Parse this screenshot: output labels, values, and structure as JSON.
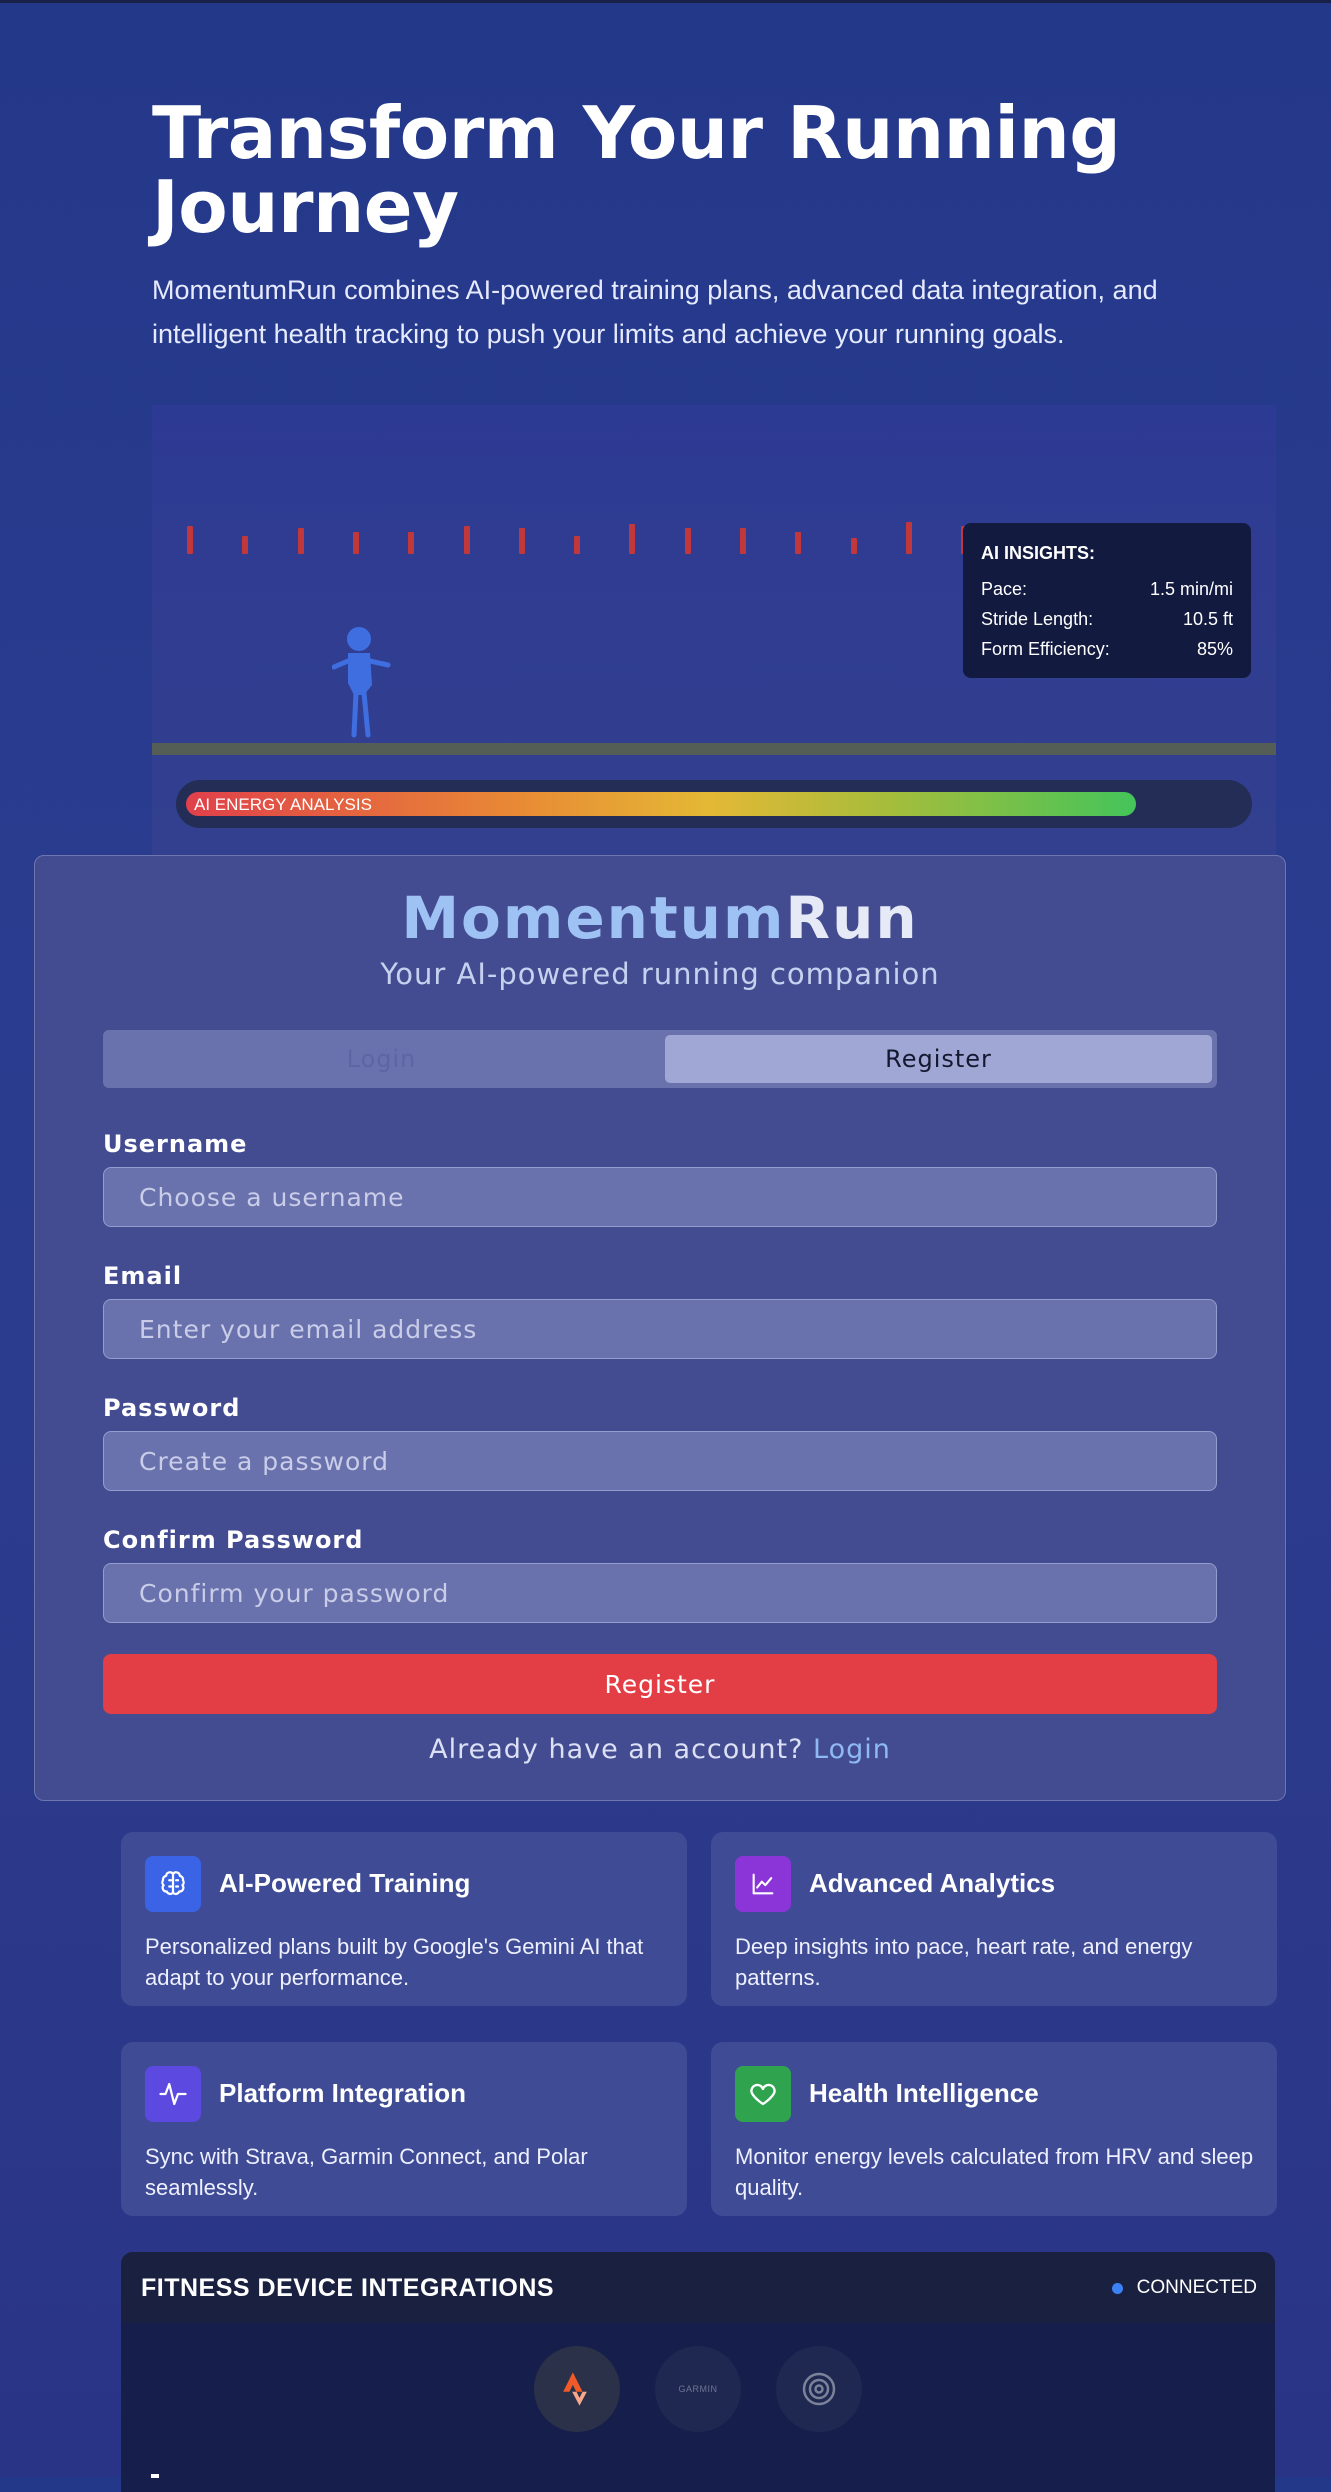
{
  "hero": {
    "title": "Transform Your Running Journey",
    "subtitle": "MomentumRun combines AI-powered training plans, advanced data integration, and intelligent health tracking to push your limits and achieve your running goals."
  },
  "visualization": {
    "insights_title": "AI INSIGHTS:",
    "metrics": [
      {
        "label": "Pace:",
        "value": "1.5 min/mi"
      },
      {
        "label": "Stride Length:",
        "value": "10.5 ft"
      },
      {
        "label": "Form Efficiency:",
        "value": "85%"
      }
    ],
    "energy_label": "AI ENERGY ANALYSIS",
    "energy_level": 0.9
  },
  "auth": {
    "brand_part1": "Momentum",
    "brand_part2": "Run",
    "tagline": "Your AI-powered running companion",
    "tabs": {
      "login": "Login",
      "register": "Register"
    },
    "fields": [
      {
        "label": "Username",
        "placeholder": "Choose a username",
        "value": ""
      },
      {
        "label": "Email",
        "placeholder": "Enter your email address",
        "value": ""
      },
      {
        "label": "Password",
        "placeholder": "Create a password",
        "value": ""
      },
      {
        "label": "Confirm Password",
        "placeholder": "Confirm your password",
        "value": ""
      }
    ],
    "submit_label": "Register",
    "switch_text": "Already have an account?",
    "switch_link": "Login"
  },
  "features": [
    {
      "title": "AI-Powered Training",
      "desc": "Personalized plans built by Google's Gemini AI that adapt to your performance.",
      "icon": "brain-icon",
      "color": "#3b63e6"
    },
    {
      "title": "Advanced Analytics",
      "desc": "Deep insights into pace, heart rate, and energy patterns.",
      "icon": "chart-line-icon",
      "color": "#8b35d9"
    },
    {
      "title": "Platform Integration",
      "desc": "Sync with Strava, Garmin Connect, and Polar seamlessly.",
      "icon": "activity-icon",
      "color": "#5b49e0"
    },
    {
      "title": "Health Intelligence",
      "desc": "Monitor energy levels calculated from HRV and sleep quality.",
      "icon": "heart-icon",
      "color": "#2fa34e"
    }
  ],
  "devices": {
    "title": "FITNESS DEVICE INTEGRATIONS",
    "status": "CONNECTED",
    "items": [
      {
        "name": "strava",
        "icon": "strava-icon"
      },
      {
        "name": "garmin",
        "icon": "garmin-icon",
        "logo_text": "GARMIN"
      },
      {
        "name": "polar",
        "icon": "polar-icon"
      }
    ]
  },
  "colors": {
    "accent_red": "#e33e45",
    "brand_blue": "#9ec2f4",
    "background": "#2a3c8f",
    "connected_dot": "#3b82f6"
  }
}
